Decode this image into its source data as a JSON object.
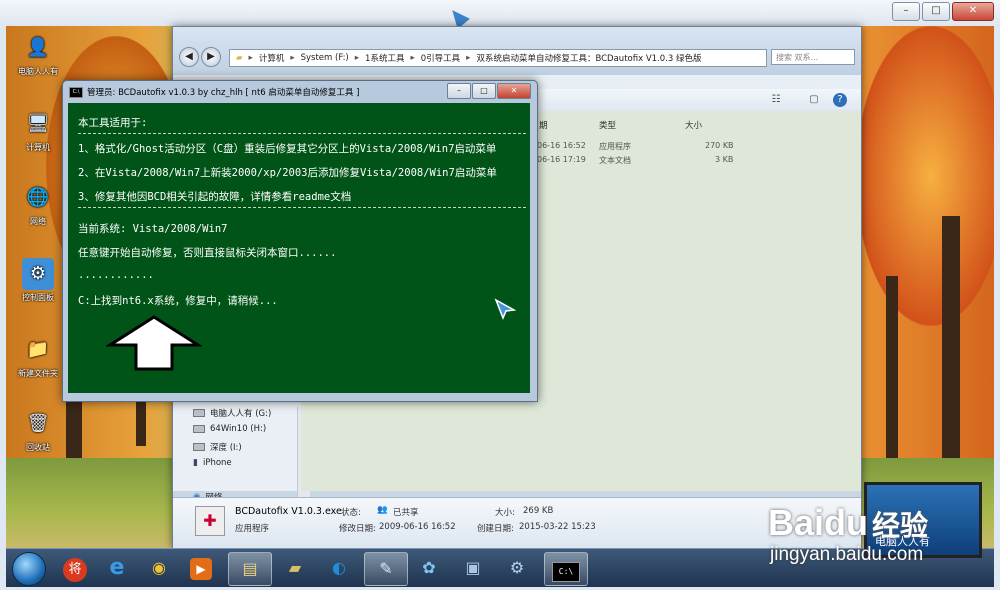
{
  "outer_window": {
    "controls": [
      "–",
      "□",
      "✕"
    ]
  },
  "desktop": {
    "icons": [
      {
        "label": "电脑人人有",
        "glyph": "👤"
      },
      {
        "label": "计算机",
        "glyph": "🖥"
      },
      {
        "label": "网络",
        "glyph": "🌐"
      },
      {
        "label": "控制面板",
        "glyph": "⚙"
      },
      {
        "label": "新建文件夹",
        "glyph": "📁"
      },
      {
        "label": "回收站",
        "glyph": "🗑"
      }
    ]
  },
  "explorer": {
    "address_parts": [
      "计算机",
      "System (F:)",
      "1系统工具",
      "0引导工具",
      "双系统启动菜单自动修复工具：BCDautofix V1.0.3 绿色版"
    ],
    "search_placeholder": "搜索 双系...",
    "columns": {
      "type": "类型",
      "size": "大小"
    },
    "partial_col": "期",
    "rows": [
      {
        "date": "06-16 16:52",
        "type": "应用程序",
        "size": "270 KB"
      },
      {
        "date": "06-16 17:19",
        "type": "文本文档",
        "size": "3 KB"
      }
    ],
    "nav_items": [
      {
        "label": "电脑人人有 (G:)"
      },
      {
        "label": "64Win10 (H:)"
      },
      {
        "label": "深度 (I:)"
      },
      {
        "label": "iPhone"
      }
    ],
    "network_label": "网络",
    "details": {
      "filename": "BCDautofix V1.0.3.exe",
      "filetype": "应用程序",
      "state_label": "状态:",
      "state_value": "已共享",
      "modified_label": "修改日期:",
      "modified_value": "2009-06-16 16:52",
      "size_label": "大小:",
      "size_value": "269 KB",
      "created_label": "创建日期:",
      "created_value": "2015-03-22 15:23"
    }
  },
  "cmd": {
    "title": "管理员: BCDautofix v1.0.3 by chz_hlh  [ nt6 启动菜单自动修复工具 ]",
    "icon_text": "C:\\",
    "controls": [
      "–",
      "□",
      "✕"
    ],
    "lines": {
      "intro": "本工具适用于:",
      "item1": "1、格式化/Ghost活动分区（C盘）重装后修复其它分区上的Vista/2008/Win7启动菜单",
      "item2": "2、在Vista/2008/Win7上新装2000/xp/2003后添加修复Vista/2008/Win7启动菜单",
      "item3": "3、修复其他因BCD相关引起的故障，详情参看readme文档",
      "current_system": "当前系统: Vista/2008/Win7",
      "prompt": "任意键开始自动修复，否则直接鼠标关闭本窗口......",
      "dots": "............",
      "status": "C:上找到nt6.x系统，修复中，请稍候..."
    }
  },
  "taskbar": {
    "apps": [
      {
        "name": "360",
        "glyph": "将",
        "color": "#d83b1d"
      },
      {
        "name": "ie",
        "glyph": "e",
        "color": "#2a82d8"
      },
      {
        "name": "chrome",
        "glyph": "◉",
        "color": "#3c9a3c"
      },
      {
        "name": "media",
        "glyph": "▶",
        "color": "#e36c17"
      },
      {
        "name": "explorer",
        "glyph": "▤",
        "color": "#d9b65b"
      },
      {
        "name": "folder",
        "glyph": "▰",
        "color": "#d7c25f"
      },
      {
        "name": "browser",
        "glyph": "◐",
        "color": "#1e8fd6"
      },
      {
        "name": "notes",
        "glyph": "✎",
        "color": "#9ab1d0"
      },
      {
        "name": "flower",
        "glyph": "✿",
        "color": "#7ec7f0"
      },
      {
        "name": "display",
        "glyph": "▣",
        "color": "#a9c6e4"
      },
      {
        "name": "tool",
        "glyph": "⚙",
        "color": "#b5d1ee"
      },
      {
        "name": "console",
        "glyph": "C:\\",
        "color": "#cccccc"
      }
    ]
  },
  "watermark": {
    "brand": "Baidu",
    "brand_cn": "经验",
    "url": "jingyan.baidu.com",
    "screen_text": "电脑人人有"
  }
}
